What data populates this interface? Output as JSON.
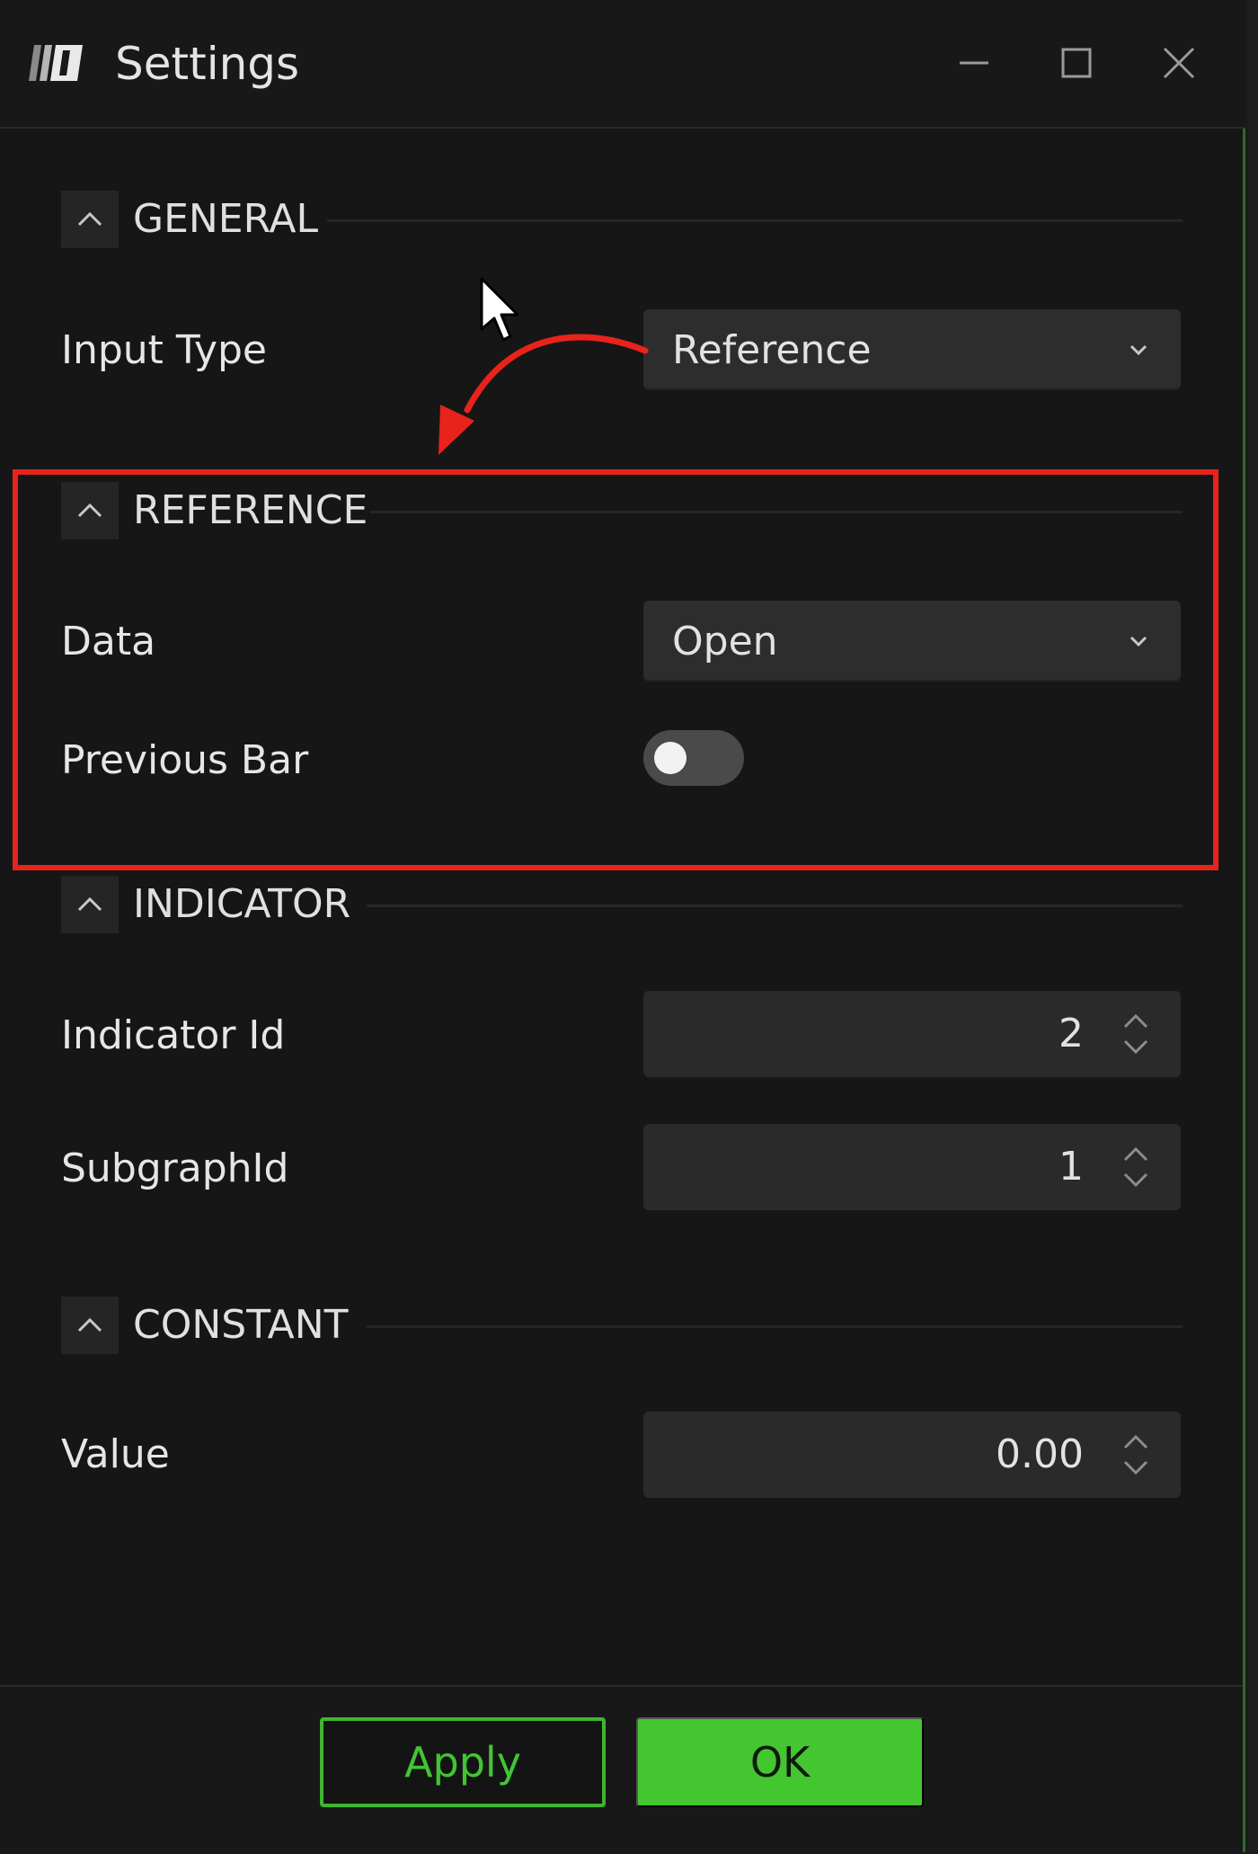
{
  "window": {
    "title": "Settings",
    "controls": [
      "minimize-icon",
      "maximize-icon",
      "close-icon"
    ]
  },
  "sections": {
    "general": {
      "title": "GENERAL",
      "input_type_label": "Input Type",
      "input_type_value": "Reference"
    },
    "reference": {
      "title": "REFERENCE",
      "data_label": "Data",
      "data_value": "Open",
      "previous_bar_label": "Previous Bar",
      "previous_bar_enabled": false
    },
    "indicator": {
      "title": "INDICATOR",
      "indicator_id_label": "Indicator Id",
      "indicator_id_value": "2",
      "subgraph_id_label": "SubgraphId",
      "subgraph_id_value": "1"
    },
    "constant": {
      "title": "CONSTANT",
      "value_label": "Value",
      "value_value": "0.00"
    }
  },
  "footer": {
    "apply_label": "Apply",
    "ok_label": "OK"
  },
  "colors": {
    "accent_green": "#44c631",
    "annotation_red": "#e8231c",
    "background": "#161616"
  }
}
